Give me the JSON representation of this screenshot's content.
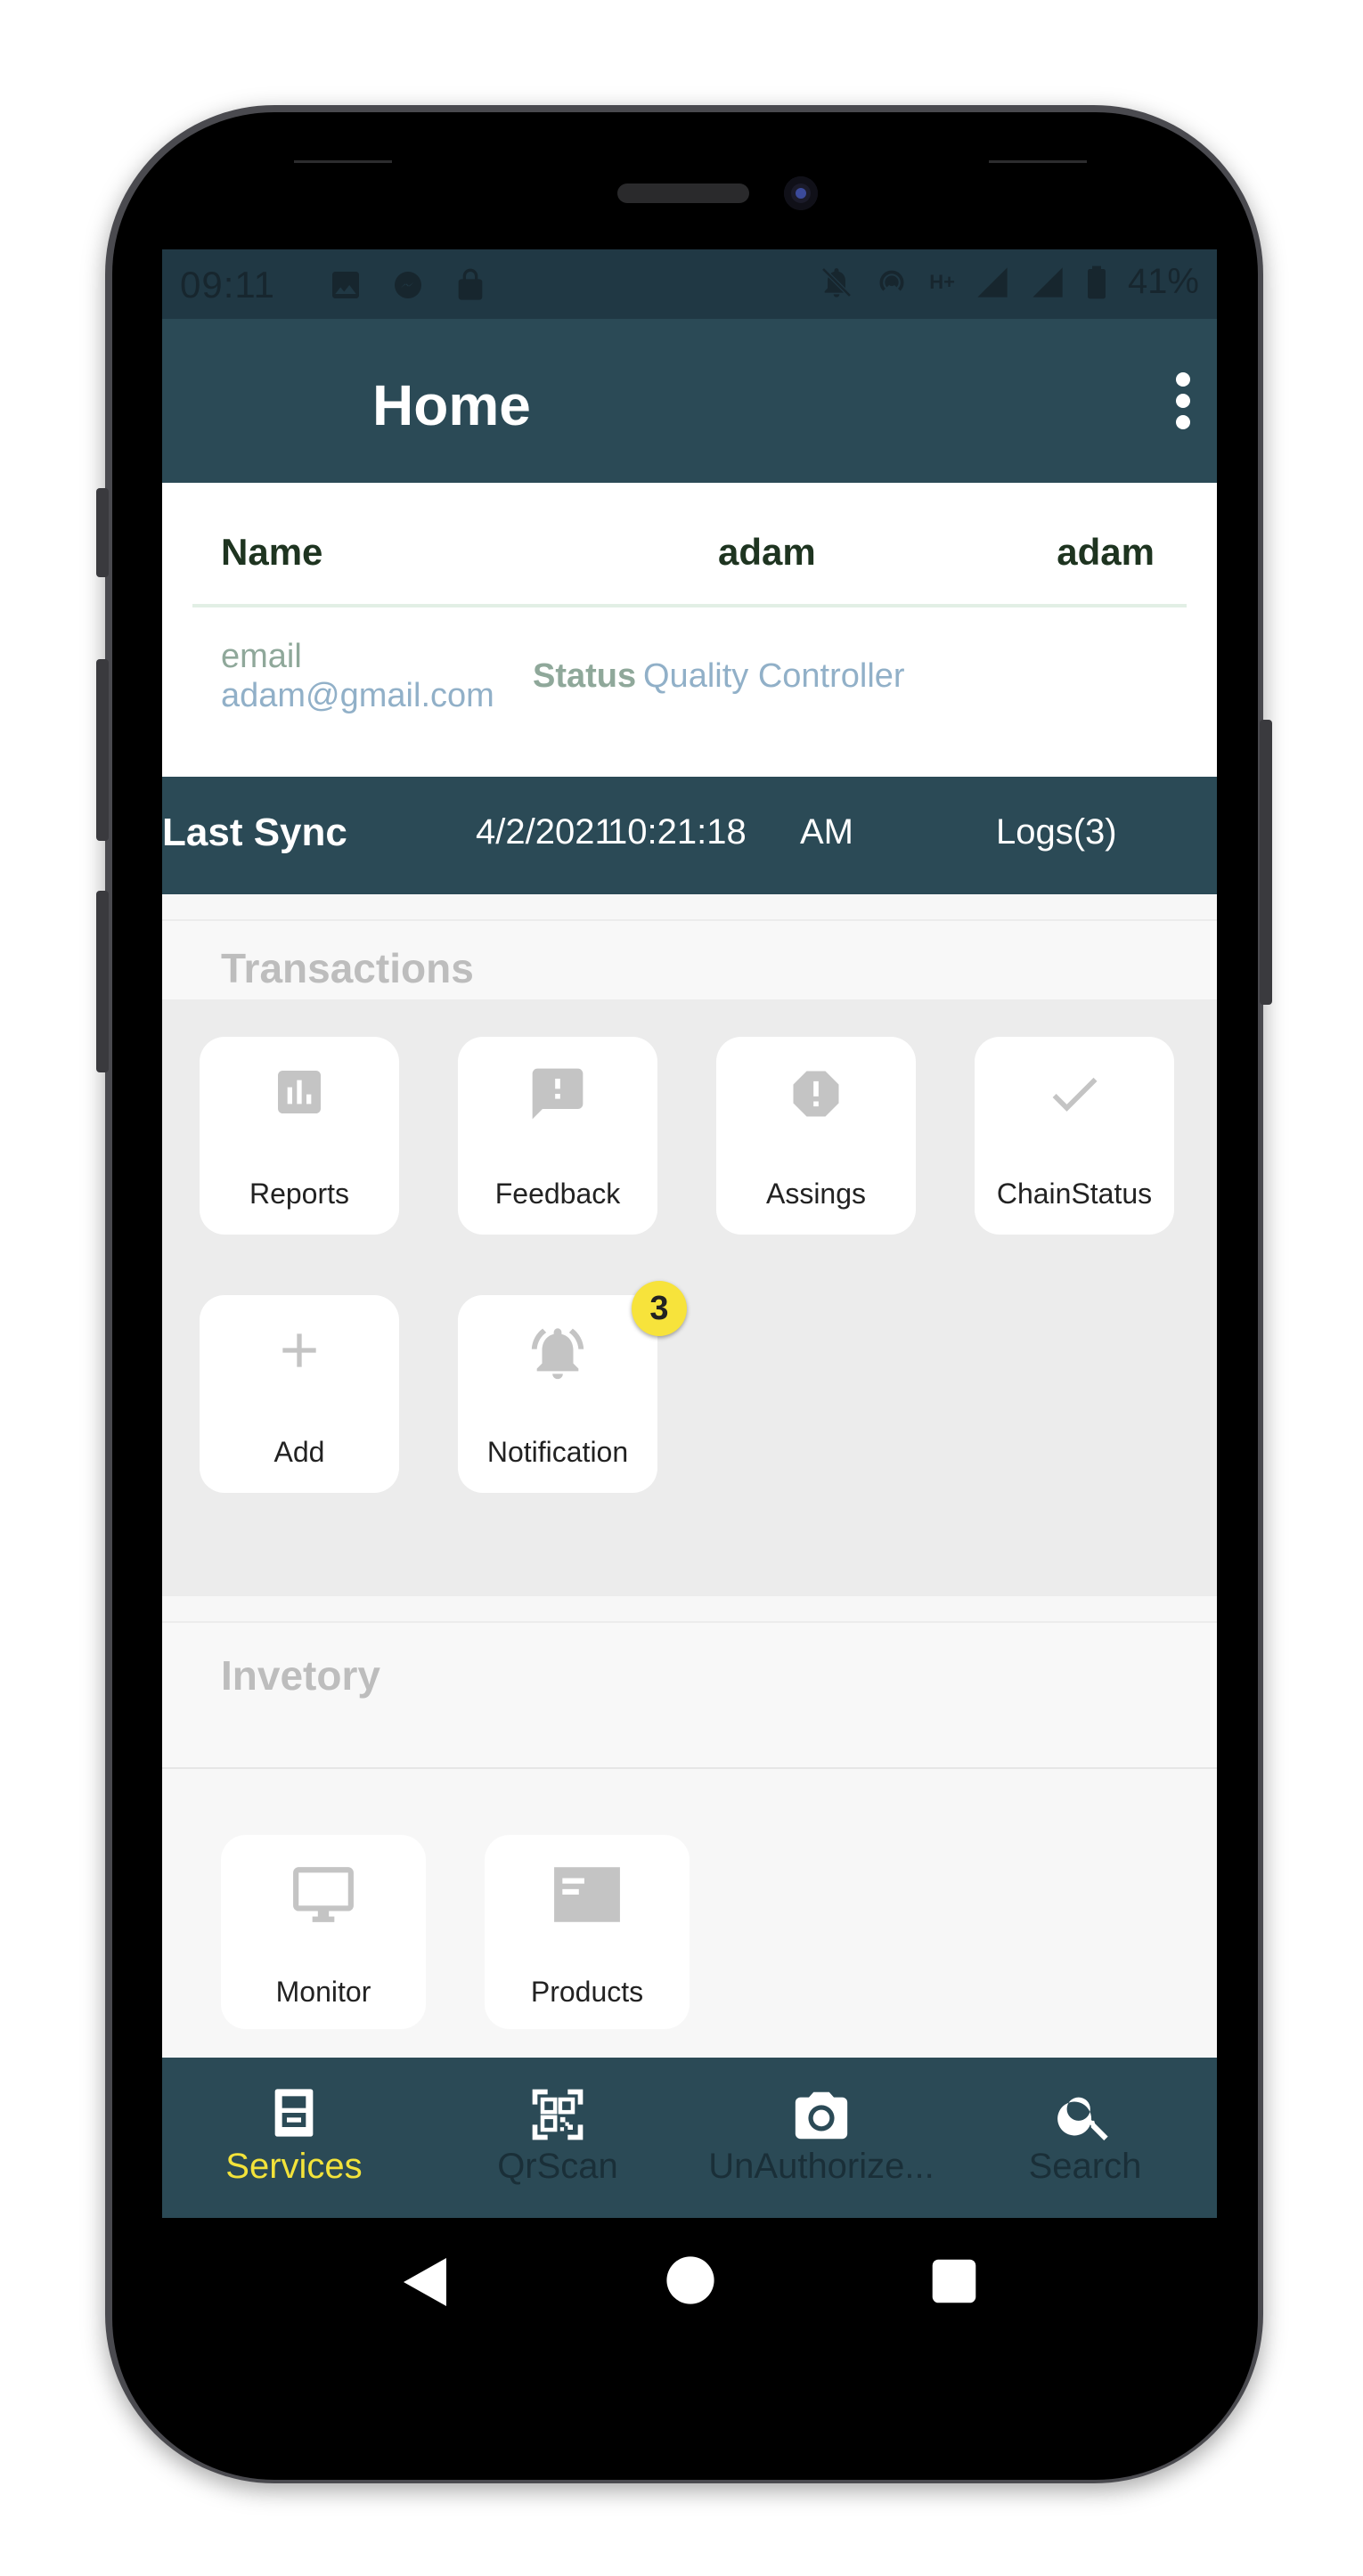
{
  "status_bar": {
    "time": "09:11",
    "network": "H+",
    "battery": "41%"
  },
  "app_bar": {
    "title": "Home",
    "menu_icon": "more-vert-icon"
  },
  "profile": {
    "name_label": "Name",
    "first_name": "adam",
    "last_name": "adam",
    "email_label": "email",
    "email": "adam@gmail.com",
    "status_label": "Status",
    "status": "Quality Controller"
  },
  "sync": {
    "label": "Last Sync",
    "date": "4/2/2021",
    "time": "10:21:18",
    "ampm": "AM",
    "logs": "Logs(3)"
  },
  "transactions": {
    "title": "Transactions",
    "tiles": [
      {
        "label": "Reports",
        "icon": "bar-chart-icon"
      },
      {
        "label": "Feedback",
        "icon": "feedback-icon"
      },
      {
        "label": "Assings",
        "icon": "error-badge-icon"
      },
      {
        "label": "ChainStatus",
        "icon": "check-icon"
      },
      {
        "label": "Add",
        "icon": "plus-icon"
      },
      {
        "label": "Notification",
        "icon": "bell-icon",
        "badge": "3"
      }
    ]
  },
  "inventory": {
    "title": "Invetory",
    "tiles": [
      {
        "label": "Monitor",
        "icon": "monitor-icon"
      },
      {
        "label": "Products",
        "icon": "product-card-icon"
      }
    ]
  },
  "bottom_nav": {
    "items": [
      {
        "label": "Services",
        "icon": "services-icon",
        "active": true
      },
      {
        "label": "QrScan",
        "icon": "qr-code-icon"
      },
      {
        "label": "UnAuthorize...",
        "icon": "camera-icon"
      },
      {
        "label": "Search",
        "icon": "search-icon"
      }
    ]
  },
  "colors": {
    "primary": "#2b4a56",
    "active_nav": "#f3e33a",
    "inactive_nav": "#1a2f38",
    "badge": "#f7e33b",
    "tile_icon": "#c4c4c4"
  }
}
